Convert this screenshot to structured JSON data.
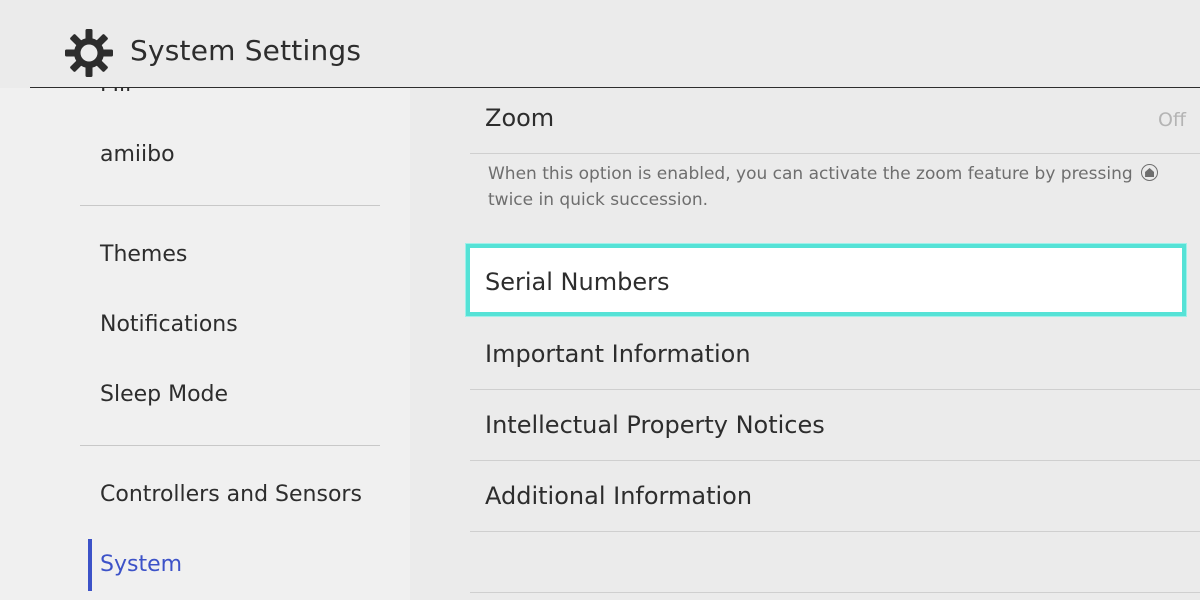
{
  "header": {
    "title": "System Settings",
    "icon": "gear-icon"
  },
  "sidebar": {
    "peek_label": "Mii",
    "items": [
      {
        "label": "amiibo"
      },
      {
        "label": "Themes"
      },
      {
        "label": "Notifications"
      },
      {
        "label": "Sleep Mode"
      },
      {
        "label": "Controllers and Sensors"
      },
      {
        "label": "System",
        "active": true
      }
    ],
    "active_color": "#3c52c8"
  },
  "main": {
    "zoom": {
      "label": "Zoom",
      "value": "Off",
      "description_before": "When this option is enabled, you can activate the zoom feature by pressing",
      "description_after": "twice in quick succession.",
      "inline_icon": "home-button-icon"
    },
    "rows": [
      {
        "label": "Serial Numbers",
        "selected": true
      },
      {
        "label": "Important Information"
      },
      {
        "label": "Intellectual Property Notices"
      },
      {
        "label": "Additional Information"
      }
    ],
    "selection_color": "#55e2d6"
  }
}
